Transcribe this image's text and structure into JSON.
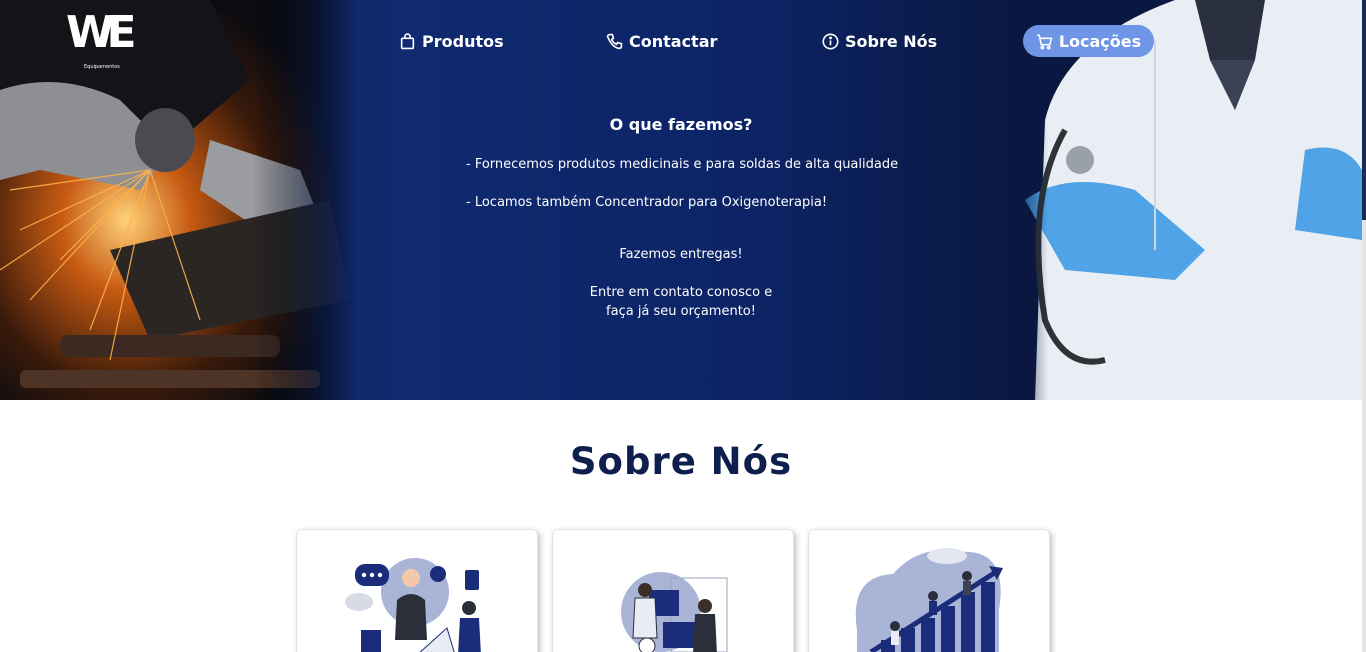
{
  "brand": {
    "logo_text": "WE",
    "logo_subtitle": "Equipamentos"
  },
  "nav": {
    "produtos": "Produtos",
    "contactar": "Contactar",
    "sobre": "Sobre Nós",
    "locacoes": "Locações"
  },
  "hero": {
    "title": "O que fazemos?",
    "line1": "- Fornecemos produtos medicinais e para soldas de alta qualidade",
    "line2": "- Locamos também Concentrador para Oxigenoterapia!",
    "line3": "Fazemos entregas!",
    "line4": "Entre em contato conosco e",
    "line5": "faça já seu orçamento!"
  },
  "about": {
    "title": "Sobre Nós"
  },
  "colors": {
    "accent": "#6f95e6",
    "navy": "#0f1f4d"
  }
}
